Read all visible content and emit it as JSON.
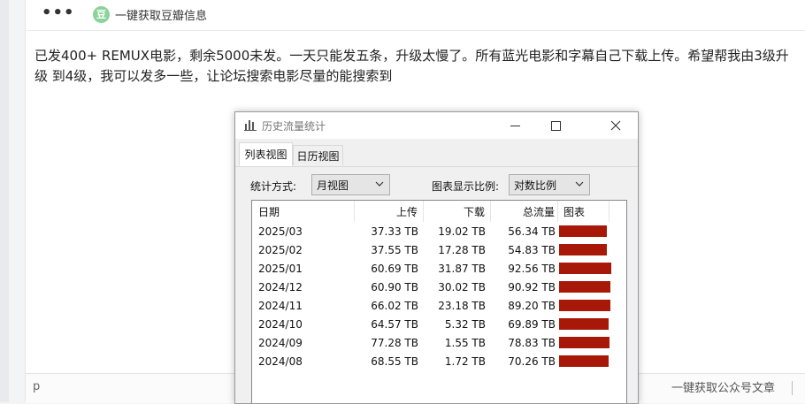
{
  "toolbar": {
    "douban_icon_char": "豆",
    "douban_label": "一键获取豆瓣信息"
  },
  "post": {
    "text": "已发400+ REMUX电影，剩余5000未发。一天只能发五条，升级太慢了。所有蓝光电影和字幕自己下载上传。希望帮我由3级升级 到4级，我可以发多一些，让论坛搜索电影尽量的能搜索到"
  },
  "editor_footer": {
    "path": "p",
    "wechat_label": "一键获取公众号文章"
  },
  "dialog": {
    "title": "历史流量统计",
    "tabs": [
      {
        "label": "列表视图"
      },
      {
        "label": "日历视图"
      }
    ],
    "stat_mode_label": "统计方式:",
    "stat_mode_value": "月视图",
    "scale_label": "图表显示比例:",
    "scale_value": "对数比例",
    "columns": {
      "date": "日期",
      "upload": "上传",
      "download": "下载",
      "total": "总流量",
      "chart": "图表"
    },
    "rows": [
      {
        "date": "2025/03",
        "upload": "37.33 TB",
        "download": "19.02 TB",
        "total": "56.34 TB",
        "bar_fraction": 0.91
      },
      {
        "date": "2025/02",
        "upload": "37.55 TB",
        "download": "17.28 TB",
        "total": "54.83 TB",
        "bar_fraction": 0.91
      },
      {
        "date": "2025/01",
        "upload": "60.69 TB",
        "download": "31.87 TB",
        "total": "92.56 TB",
        "bar_fraction": 1.0
      },
      {
        "date": "2024/12",
        "upload": "60.90 TB",
        "download": "30.02 TB",
        "total": "90.92 TB",
        "bar_fraction": 0.99
      },
      {
        "date": "2024/11",
        "upload": "66.02 TB",
        "download": "23.18 TB",
        "total": "89.20 TB",
        "bar_fraction": 0.99
      },
      {
        "date": "2024/10",
        "upload": "64.57 TB",
        "download": "5.32 TB",
        "total": "69.89 TB",
        "bar_fraction": 0.95
      },
      {
        "date": "2024/09",
        "upload": "77.28 TB",
        "download": "1.55 TB",
        "total": "78.83 TB",
        "bar_fraction": 0.97
      },
      {
        "date": "2024/08",
        "upload": "68.55 TB",
        "download": "1.72 TB",
        "total": "70.26 TB",
        "bar_fraction": 0.95
      }
    ],
    "bar_color": "#a81808"
  }
}
